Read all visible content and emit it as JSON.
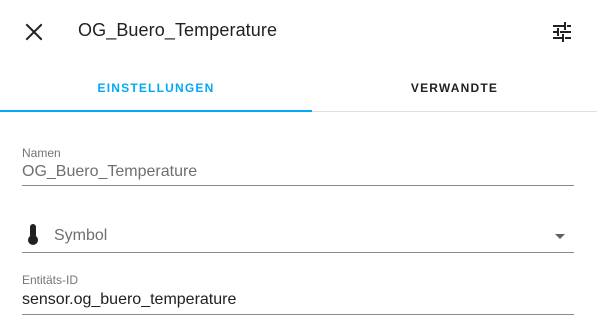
{
  "dialog": {
    "title": "OG_Buero_Temperature",
    "close_icon": "close-icon",
    "settings_icon": "tune-icon"
  },
  "tabs": [
    {
      "label": "EINSTELLUNGEN",
      "active": true
    },
    {
      "label": "VERWANDTE",
      "active": false
    }
  ],
  "form": {
    "name": {
      "label": "Namen",
      "value": "OG_Buero_Temperature"
    },
    "icon": {
      "placeholder": "Symbol",
      "icon": "thermometer-icon"
    },
    "entity_id": {
      "label": "Entitäts-ID",
      "value": "sensor.og_buero_temperature"
    }
  },
  "colors": {
    "accent": "#03a9f4",
    "text": "#212121",
    "secondary_text": "#757575",
    "divider": "#e0e0e0"
  }
}
